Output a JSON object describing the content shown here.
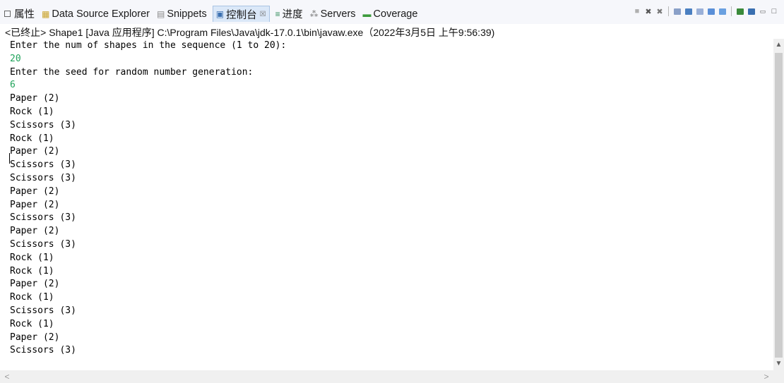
{
  "tabs": [
    {
      "label": "属性",
      "icon": "properties-icon",
      "active": false
    },
    {
      "label": "Data Source Explorer",
      "icon": "data-source-explorer-icon",
      "active": false
    },
    {
      "label": "Snippets",
      "icon": "snippets-icon",
      "active": false
    },
    {
      "label": "控制台",
      "icon": "console-icon",
      "active": true,
      "close": "☒"
    },
    {
      "label": "进度",
      "icon": "progress-icon",
      "active": false
    },
    {
      "label": "Servers",
      "icon": "servers-icon",
      "active": false
    },
    {
      "label": "Coverage",
      "icon": "coverage-icon",
      "active": false
    }
  ],
  "toolbar_icons": [
    "terminate-icon",
    "remove-launch-icon",
    "remove-all-terminated-icon",
    "scroll-lock-icon",
    "show-console-on-output-icon",
    "word-wrap-icon",
    "pin-console-icon",
    "display-selected-console-icon",
    "open-console-icon",
    "view-menu-icon",
    "minimize-icon",
    "maximize-icon"
  ],
  "status_line": "<已终止> Shape1 [Java 应用程序] C:\\Program Files\\Java\\jdk-17.0.1\\bin\\javaw.exe（2022年3月5日 上午9:56:39)",
  "console_lines": [
    {
      "text": "Enter the num of shapes in the sequence (1 to 20):",
      "input": false
    },
    {
      "text": "20",
      "input": true
    },
    {
      "text": "Enter the seed for random number generation:",
      "input": false
    },
    {
      "text": "6",
      "input": true
    },
    {
      "text": "Paper (2)",
      "input": false
    },
    {
      "text": "Rock (1)",
      "input": false
    },
    {
      "text": "Scissors (3)",
      "input": false
    },
    {
      "text": "Rock (1)",
      "input": false
    },
    {
      "text": "Paper (2)",
      "input": false
    },
    {
      "text": "Scissors (3)",
      "input": false
    },
    {
      "text": "Scissors (3)",
      "input": false
    },
    {
      "text": "Paper (2)",
      "input": false
    },
    {
      "text": "Paper (2)",
      "input": false
    },
    {
      "text": "Scissors (3)",
      "input": false
    },
    {
      "text": "Paper (2)",
      "input": false
    },
    {
      "text": "Scissors (3)",
      "input": false
    },
    {
      "text": "Rock (1)",
      "input": false
    },
    {
      "text": "Rock (1)",
      "input": false
    },
    {
      "text": "Paper (2)",
      "input": false
    },
    {
      "text": "Rock (1)",
      "input": false
    },
    {
      "text": "Scissors (3)",
      "input": false
    },
    {
      "text": "Rock (1)",
      "input": false
    },
    {
      "text": "Paper (2)",
      "input": false
    },
    {
      "text": "Scissors (3)",
      "input": false
    }
  ],
  "colors": {
    "input_text": "#1fa35a",
    "active_tab": "#dbe8f8"
  }
}
